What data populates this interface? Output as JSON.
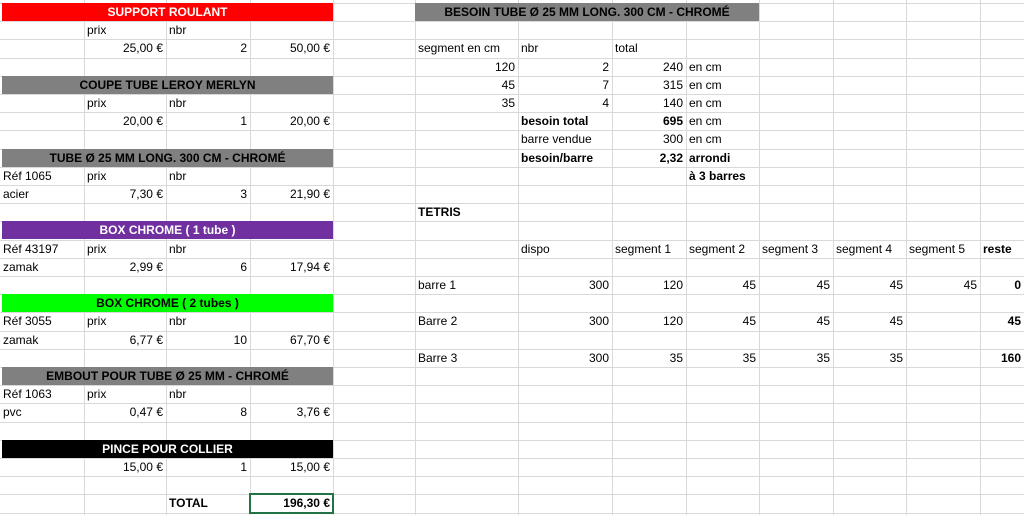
{
  "colors": {
    "red": "#ff0000",
    "gray": "#808080",
    "purple": "#7030a0",
    "green": "#00ff00",
    "black": "#000000",
    "selection": "#217346"
  },
  "left": {
    "support": {
      "title": "SUPPORT ROULANT",
      "h_prix": "prix",
      "h_nbr": "nbr",
      "prix": "25,00 €",
      "nbr": "2",
      "total": "50,00 €"
    },
    "coupe": {
      "title": "COUPE TUBE LEROY MERLYN",
      "h_prix": "prix",
      "h_nbr": "nbr",
      "prix": "20,00 €",
      "nbr": "1",
      "total": "20,00 €"
    },
    "tube": {
      "title": "TUBE Ø 25 MM LONG. 300 CM - CHROMÉ",
      "ref": "Réf 1065",
      "h_prix": "prix",
      "h_nbr": "nbr",
      "mat": "acier",
      "prix": "7,30 €",
      "nbr": "3",
      "total": "21,90 €"
    },
    "box1": {
      "title": "BOX CHROME ( 1 tube )",
      "ref": "Réf 43197",
      "h_prix": "prix",
      "h_nbr": "nbr",
      "mat": "zamak",
      "prix": "2,99 €",
      "nbr": "6",
      "total": "17,94 €"
    },
    "box2": {
      "title": "BOX CHROME ( 2 tubes )",
      "ref": "Réf 3055",
      "h_prix": "prix",
      "h_nbr": "nbr",
      "mat": "zamak",
      "prix": "6,77 €",
      "nbr": "10",
      "total": "67,70 €"
    },
    "embout": {
      "title": "EMBOUT POUR TUBE Ø 25 MM - CHROMÉ",
      "ref": "Réf 1063",
      "h_prix": "prix",
      "h_nbr": "nbr",
      "mat": "pvc",
      "prix": "0,47 €",
      "nbr": "8",
      "total": "3,76 €"
    },
    "pince": {
      "title": "PINCE POUR COLLIER",
      "prix": "15,00 €",
      "nbr": "1",
      "total": "15,00 €"
    },
    "total_label": "TOTAL",
    "total_value": "196,30 €"
  },
  "right": {
    "title": "BESOIN TUBE Ø 25 MM LONG. 300 CM - CHROMÉ",
    "h_segment": "segment en cm",
    "h_nbr": "nbr",
    "h_total": "total",
    "rows": [
      {
        "seg": "120",
        "nbr": "2",
        "total": "240",
        "unit": "en cm"
      },
      {
        "seg": "45",
        "nbr": "7",
        "total": "315",
        "unit": "en cm"
      },
      {
        "seg": "35",
        "nbr": "4",
        "total": "140",
        "unit": "en cm"
      }
    ],
    "besoin_total_label": "besoin total",
    "besoin_total": "695",
    "besoin_total_unit": "en cm",
    "barre_vendue_label": "barre vendue",
    "barre_vendue": "300",
    "barre_vendue_unit": "en cm",
    "besoin_barre_label": "besoin/barre",
    "besoin_barre": "2,32",
    "besoin_barre_note": "arrondi",
    "barres_note": "à 3 barres",
    "tetris": {
      "title": "TETRIS",
      "headers": [
        "dispo",
        "segment 1",
        "segment 2",
        "segment 3",
        "segment 4",
        "segment 5",
        "reste"
      ],
      "rows": [
        {
          "label": "barre 1",
          "values": [
            "300",
            "120",
            "45",
            "45",
            "45",
            "45",
            "0"
          ]
        },
        {
          "label": "Barre 2",
          "values": [
            "300",
            "120",
            "45",
            "45",
            "45",
            "",
            "45"
          ]
        },
        {
          "label": "Barre 3",
          "values": [
            "300",
            "35",
            "35",
            "35",
            "35",
            "",
            "160"
          ]
        }
      ]
    }
  }
}
